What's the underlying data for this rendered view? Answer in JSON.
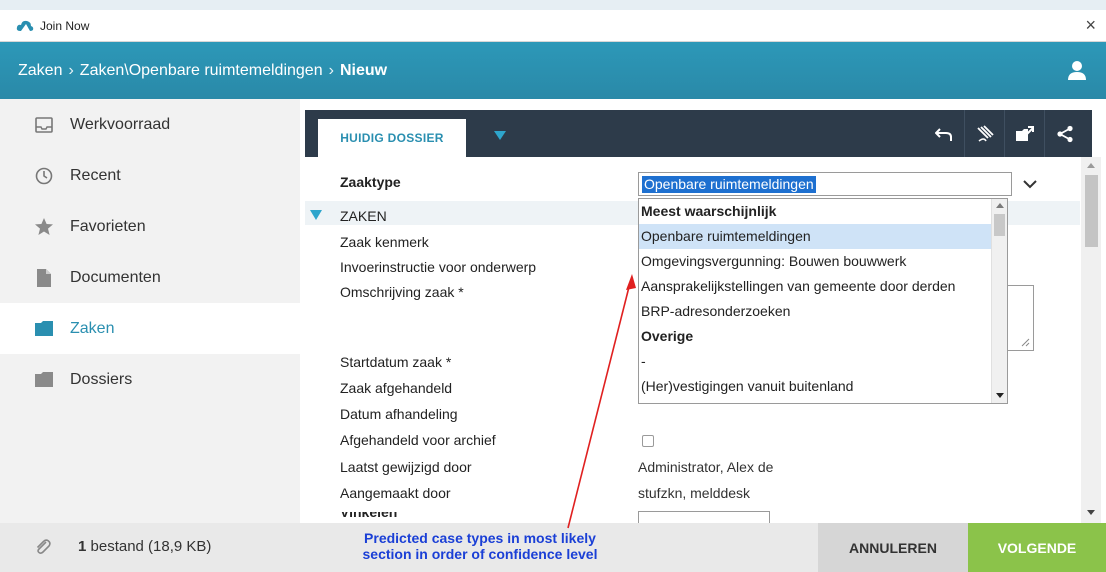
{
  "window": {
    "title": "Join Now",
    "close_glyph": "×"
  },
  "breadcrumb": {
    "items": [
      "Zaken",
      "Zaken\\Openbare ruimtemeldingen"
    ],
    "current": "Nieuw",
    "separator": "›"
  },
  "sidebar": {
    "items": [
      {
        "label": "Werkvoorraad",
        "icon": "inbox-icon"
      },
      {
        "label": "Recent",
        "icon": "clock-icon"
      },
      {
        "label": "Favorieten",
        "icon": "star-icon"
      },
      {
        "label": "Documenten",
        "icon": "document-icon"
      },
      {
        "label": "Zaken",
        "icon": "folder-icon",
        "active": true
      },
      {
        "label": "Dossiers",
        "icon": "folder-icon"
      }
    ]
  },
  "toolbar": {
    "active_tab": "HUIDIG DOSSIER",
    "icons": [
      "undo-icon",
      "signature-icon",
      "export-icon",
      "share-icon"
    ]
  },
  "form": {
    "zaaktype_label": "Zaaktype",
    "zaaktype_value": "Openbare ruimtemeldingen",
    "section_title": "ZAKEN",
    "fields": [
      "Zaak kenmerk",
      "Invoerinstructie voor onderwerp",
      "Omschrijving zaak *",
      "Startdatum zaak *",
      "Zaak afgehandeld",
      "Datum afhandeling",
      "Afgehandeld voor archief",
      "Laatst gewijzigd door",
      "Aangemaakt door"
    ],
    "laatst_gewijzigd_value": "Administrator, Alex de",
    "aangemaakt_value": "stufzkn, melddesk",
    "partial_label": "Vinkelent..."
  },
  "dropdown": {
    "items": [
      {
        "label": "Meest waarschijnlijk",
        "group": true
      },
      {
        "label": "Openbare ruimtemeldingen",
        "selected": true
      },
      {
        "label": "Omgevingsvergunning: Bouwen bouwwerk"
      },
      {
        "label": "Aansprakelijkstellingen van gemeente door derden"
      },
      {
        "label": "BRP-adresonderzoeken"
      },
      {
        "label": "Overige",
        "group": true
      },
      {
        "label": "-"
      },
      {
        "label": "(Her)vestigingen vanuit buitenland"
      }
    ]
  },
  "footer": {
    "file_count": "1",
    "file_text": "bestand (18,9 KB)",
    "cancel_label": "ANNULEREN",
    "next_label": "VOLGENDE"
  },
  "annotation": {
    "line1": "Predicted case types in most likely",
    "line2": "section in order of confidence level",
    "color": "#1a3fd6",
    "arrow_color": "#e02020"
  },
  "colors": {
    "header": "#2a8fb0",
    "toolbar": "#2d3b4a",
    "accent": "#2ea5cc",
    "next_button": "#8bc34a"
  }
}
